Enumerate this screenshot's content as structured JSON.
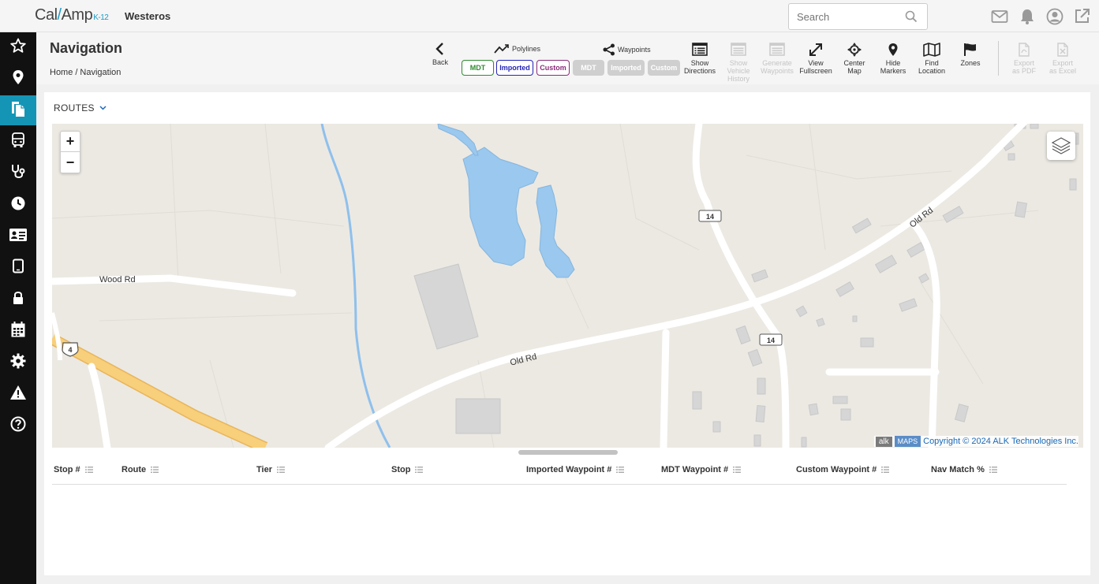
{
  "app": {
    "logo": {
      "brand_left": "Cal",
      "brand_right": "Amp",
      "brand_suffix": "K-12"
    },
    "org_name": "Westeros",
    "search": {
      "placeholder": "Search"
    },
    "top_icons": [
      "mail-icon",
      "bell-icon",
      "user-account-icon",
      "external-link-icon"
    ]
  },
  "sidebar": {
    "active_index": 2,
    "items": [
      "star-icon",
      "location-pin-icon",
      "documents-icon",
      "bus-icon",
      "stethoscope-icon",
      "clock-icon",
      "id-card-icon",
      "tablet-icon",
      "lock-icon",
      "calendar-icon",
      "gear-icon",
      "warning-icon",
      "help-icon"
    ]
  },
  "header": {
    "title": "Navigation",
    "breadcrumb": [
      "Home",
      "/",
      "Navigation"
    ]
  },
  "toolbar": {
    "back": "Back",
    "polylines_label": "Polylines",
    "waypoints_label": "Waypoints",
    "polyline_chips": [
      "MDT",
      "Imported",
      "Custom"
    ],
    "waypoint_chips": [
      "MDT",
      "Imported",
      "Custom"
    ],
    "show_directions": [
      "Show",
      "Directions"
    ],
    "show_vehicle_history": [
      "Show",
      "Vehicle",
      "History"
    ],
    "generate_waypoints": [
      "Generate",
      "Waypoints"
    ],
    "view_fullscreen": [
      "View",
      "Fullscreen"
    ],
    "center_map": [
      "Center",
      "Map"
    ],
    "hide_markers": [
      "Hide",
      "Markers"
    ],
    "find_location": [
      "Find",
      "Location"
    ],
    "zones": "Zones",
    "export_pdf": [
      "Export",
      "as PDF"
    ],
    "export_excel": [
      "Export",
      "as Excel"
    ]
  },
  "routes": {
    "label": "ROUTES"
  },
  "map": {
    "roads": [
      "Wood Rd",
      "Old Rd",
      "Old Rd"
    ],
    "shields": [
      "14",
      "14",
      "4"
    ],
    "zoom_in": "+",
    "zoom_out": "−",
    "attribution": {
      "alk": "alk",
      "maps": "MAPS",
      "copyright": "Copyright © 2024 ALK Technologies Inc."
    },
    "colors": {
      "land": "#ece9e3",
      "water": "#9ac8ee",
      "road": "#ffffff",
      "highway": "#f7c86b",
      "building": "#d6d6d6"
    }
  },
  "table": {
    "columns": [
      "Stop #",
      "Route",
      "Tier",
      "Stop",
      "Imported Waypoint #",
      "MDT Waypoint #",
      "Custom Waypoint #",
      "Nav Match %"
    ],
    "rows": []
  },
  "colors": {
    "accent": "#1495b5",
    "sidebar_bg": "#111111"
  }
}
